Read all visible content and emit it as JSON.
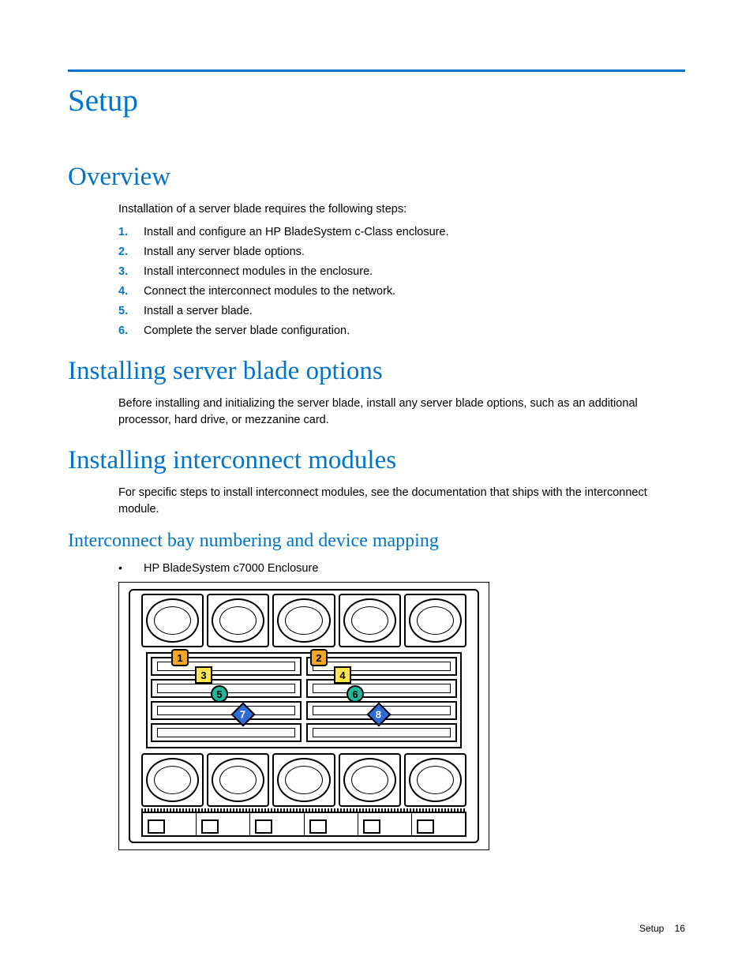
{
  "page": {
    "title": "Setup",
    "footer_section": "Setup",
    "footer_page": "16"
  },
  "overview": {
    "heading": "Overview",
    "intro": "Installation of a server blade requires the following steps:",
    "steps": [
      "Install and configure an HP BladeSystem c-Class enclosure.",
      "Install any server blade options.",
      "Install interconnect modules in the enclosure.",
      "Connect the interconnect modules to the network.",
      "Install a server blade.",
      "Complete the server blade configuration."
    ]
  },
  "options": {
    "heading": "Installing server blade options",
    "body": "Before installing and initializing the server blade, install any server blade options, such as an additional processor, hard drive, or mezzanine card."
  },
  "interconnect": {
    "heading": "Installing interconnect modules",
    "body": "For specific steps to install interconnect modules, see the documentation that ships with the interconnect module."
  },
  "bay": {
    "heading": "Interconnect bay numbering and device mapping",
    "bullet": "HP BladeSystem c7000 Enclosure",
    "labels": [
      "1",
      "2",
      "3",
      "4",
      "5",
      "6",
      "7",
      "8"
    ]
  }
}
